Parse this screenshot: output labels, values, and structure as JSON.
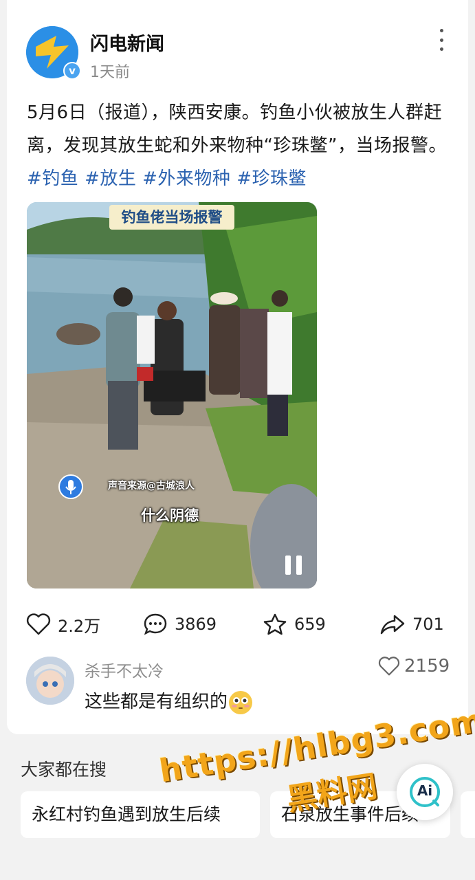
{
  "post": {
    "author": "闪电新闻",
    "time": "1天前",
    "text": "5月6日（报道），陕西安康。钓鱼小伙被放生人群赶离，发现其放生蛇和外来物种“珍珠鳖”，当场报警。",
    "tags": [
      "#钓鱼",
      "#放生",
      "#外来物种",
      "#珍珠鳖"
    ]
  },
  "video": {
    "banner": "钓鱼佬当场报警",
    "source": "声音来源@古城浪人",
    "subtitle": "什么阴德"
  },
  "actions": {
    "likes": "2.2万",
    "comments": "3869",
    "favorites": "659",
    "shares": "701"
  },
  "top_comment": {
    "user": "杀手不太冷",
    "likes": "2159",
    "text": "这些都是有组织的"
  },
  "trending": {
    "title": "大家都在搜",
    "items": [
      "永红村钓鱼遇到放生后续",
      "石泉放生事件后续"
    ]
  },
  "ai_button": {
    "label": "Ai"
  },
  "watermark": {
    "url": "https://hlbg3.com",
    "name": "黑料网"
  },
  "colors": {
    "tag": "#2b62b0",
    "brand_blue": "#2b8fe6",
    "watermark": "#f2a51a"
  }
}
